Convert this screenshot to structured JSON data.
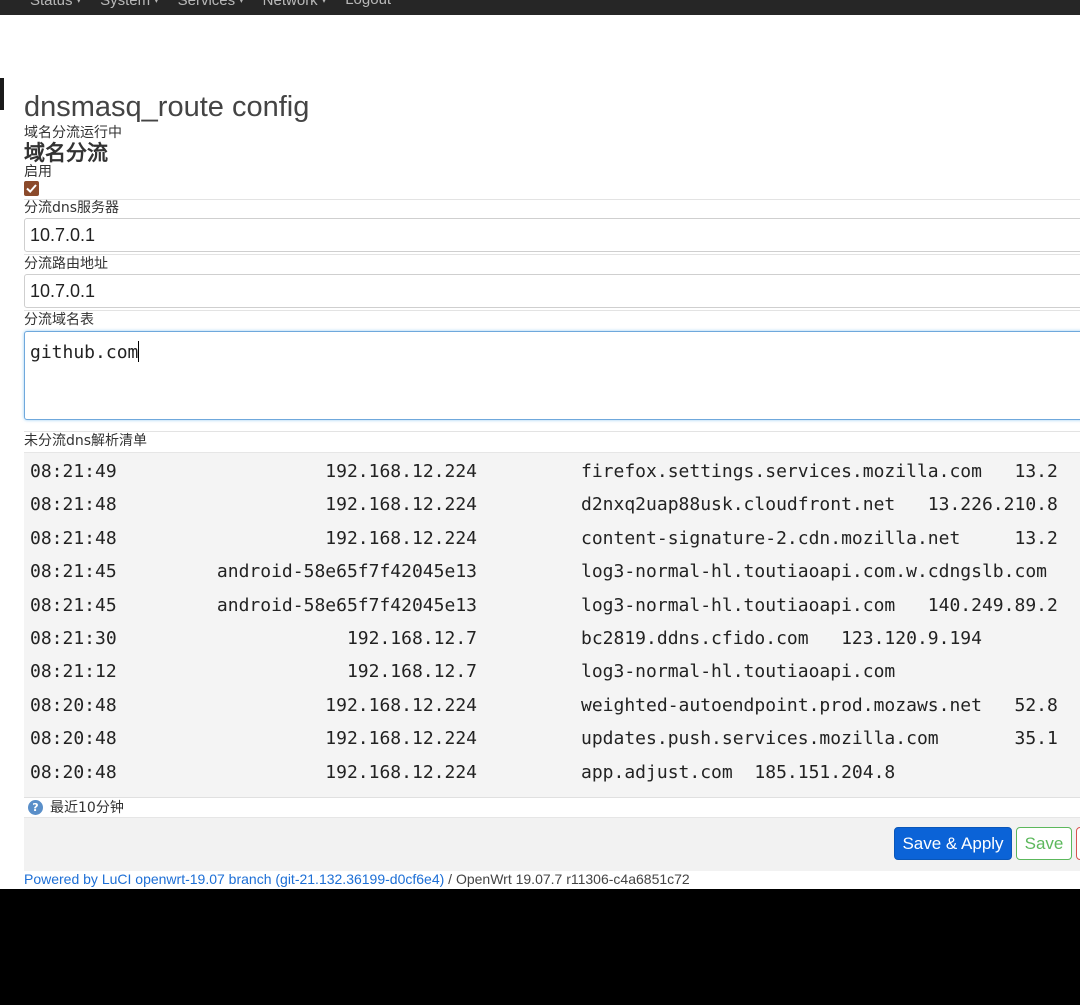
{
  "nav": {
    "items": [
      {
        "label": "Status"
      },
      {
        "label": "System"
      },
      {
        "label": "Services"
      },
      {
        "label": "Network"
      },
      {
        "label": "Logout"
      }
    ]
  },
  "page": {
    "title": "dnsmasq_route config",
    "status": "域名分流运行中",
    "section_title": "域名分流"
  },
  "form": {
    "enable_label": "启用",
    "enable_checked": true,
    "dns_server_label": "分流dns服务器",
    "dns_server_value": "10.7.0.1",
    "route_addr_label": "分流路由地址",
    "route_addr_value": "10.7.0.1",
    "domain_list_label": "分流域名表",
    "domain_list_value": "github.com",
    "unresolved_label": "未分流dns解析清单",
    "help_text": "最近10分钟"
  },
  "dns_log": [
    {
      "time": "08:21:49",
      "client": "192.168.12.224",
      "domain": "firefox.settings.services.mozilla.com   13.2"
    },
    {
      "time": "08:21:48",
      "client": "192.168.12.224",
      "domain": "d2nxq2uap88usk.cloudfront.net   13.226.210.8"
    },
    {
      "time": "08:21:48",
      "client": "192.168.12.224",
      "domain": "content-signature-2.cdn.mozilla.net     13.2"
    },
    {
      "time": "08:21:45",
      "client": "android-58e65f7f42045e13",
      "domain": "log3-normal-hl.toutiaoapi.com.w.cdngslb.com"
    },
    {
      "time": "08:21:45",
      "client": "android-58e65f7f42045e13",
      "domain": "log3-normal-hl.toutiaoapi.com   140.249.89.2"
    },
    {
      "time": "08:21:30",
      "client": "192.168.12.7",
      "domain": "bc2819.ddns.cfido.com   123.120.9.194"
    },
    {
      "time": "08:21:12",
      "client": "192.168.12.7",
      "domain": "log3-normal-hl.toutiaoapi.com"
    },
    {
      "time": "08:20:48",
      "client": "192.168.12.224",
      "domain": "weighted-autoendpoint.prod.mozaws.net   52.8"
    },
    {
      "time": "08:20:48",
      "client": "192.168.12.224",
      "domain": "updates.push.services.mozilla.com       35.1"
    },
    {
      "time": "08:20:48",
      "client": "192.168.12.224",
      "domain": "app.adjust.com  185.151.204.8"
    }
  ],
  "actions": {
    "save_apply_label": "Save & Apply",
    "save_label": "Save",
    "reset_label": ""
  },
  "footer": {
    "luci_link": "Powered by LuCI openwrt-19.07 branch (git-21.132.36199-d0cf6e4)",
    "separator": " / ",
    "version": "OpenWrt 19.07.7 r11306-c4a6851c72"
  },
  "colors": {
    "primary_button": "#0b63d7",
    "save_button": "#5cb85c",
    "reset_button": "#d9534f",
    "link": "#1d6fd6",
    "checkbox": "#8b4a2b"
  }
}
